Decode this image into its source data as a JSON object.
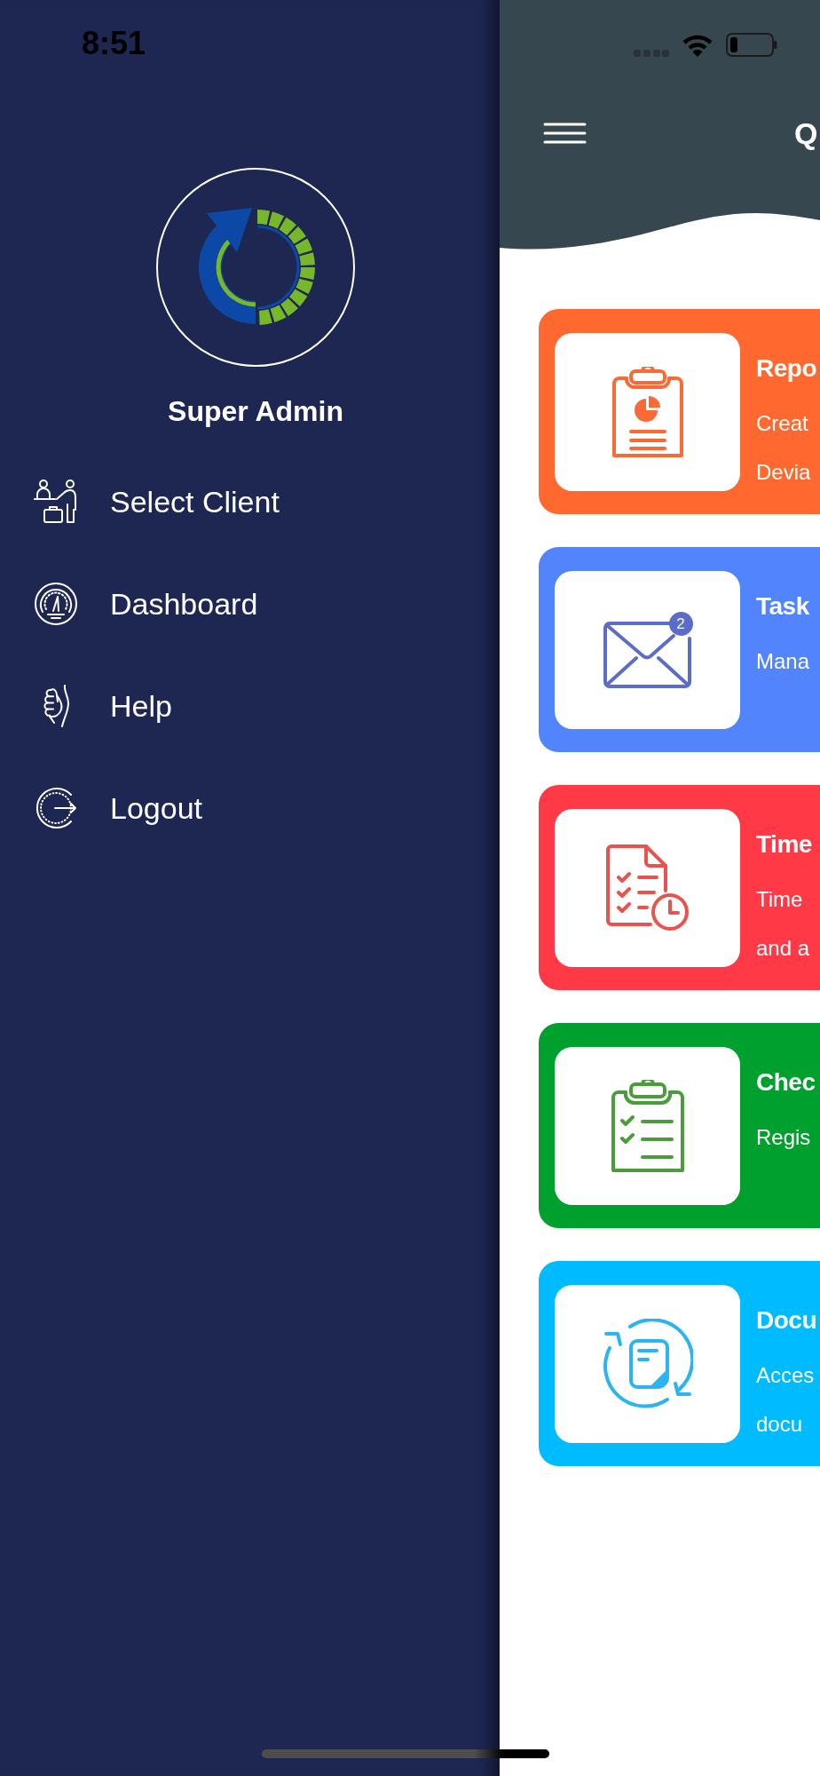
{
  "status_bar": {
    "time": "8:51"
  },
  "sidebar": {
    "user_name": "Super Admin",
    "items": [
      {
        "label": "Select Client",
        "kind": "client"
      },
      {
        "label": "Dashboard",
        "kind": "dashboard"
      },
      {
        "label": "Help",
        "kind": "help"
      },
      {
        "label": "Logout",
        "kind": "logout"
      }
    ]
  },
  "header": {
    "title": "Q"
  },
  "cards": [
    {
      "kind": "report",
      "title": "Repo",
      "description_lines": [
        "Creat",
        "Devia"
      ],
      "color": "#ff6930"
    },
    {
      "kind": "tasks",
      "title": "Task",
      "description_lines": [
        "Mana"
      ],
      "badge": "2",
      "color": "#5285fd"
    },
    {
      "kind": "timesheet",
      "title": "Time",
      "description_lines": [
        "Time",
        "and a"
      ],
      "color": "#ff3a46"
    },
    {
      "kind": "checklist",
      "title": "Chec",
      "description_lines": [
        "Regis"
      ],
      "color": "#00a02e"
    },
    {
      "kind": "documents",
      "title": "Docu",
      "description_lines": [
        "Acces",
        "docu"
      ],
      "color": "#00bbff"
    }
  ]
}
